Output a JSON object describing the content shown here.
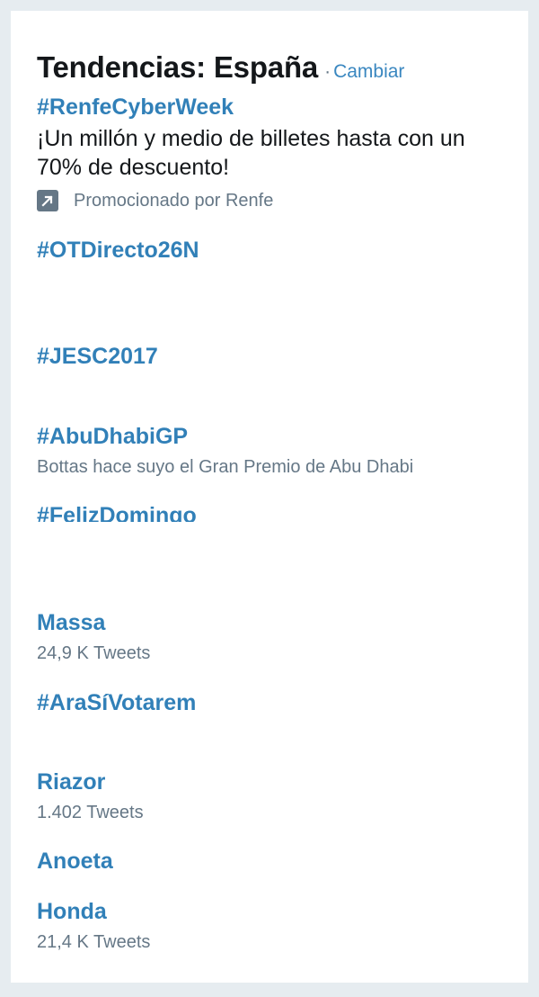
{
  "header": {
    "title": "Tendencias: España",
    "separator": "·",
    "change_label": "Cambiar"
  },
  "trends": [
    {
      "name": "#RenfeCyberWeek",
      "description": "¡Un millón y medio de billetes hasta con un 70% de descuento!",
      "promoted": "Promocionado por Renfe",
      "promoted_icon": "promoted-arrow-icon"
    },
    {
      "name": "#OTDirecto26N"
    },
    {
      "name": "#JESC2017"
    },
    {
      "name": "#AbuDhabiGP",
      "meta": "Bottas hace suyo el Gran Premio de Abu Dhabi"
    },
    {
      "name": "#FelizDomingo"
    },
    {
      "name": "Massa",
      "meta": "24,9 K Tweets"
    },
    {
      "name": "#AraSíVotarem"
    },
    {
      "name": "Riazor",
      "meta": "1.402 Tweets"
    },
    {
      "name": "Anoeta"
    },
    {
      "name": "Honda",
      "meta": "21,4 K Tweets"
    }
  ],
  "colors": {
    "background": "#e6ecf0",
    "card": "#ffffff",
    "link": "#3180b8",
    "text": "#14171a",
    "muted": "#657786"
  }
}
